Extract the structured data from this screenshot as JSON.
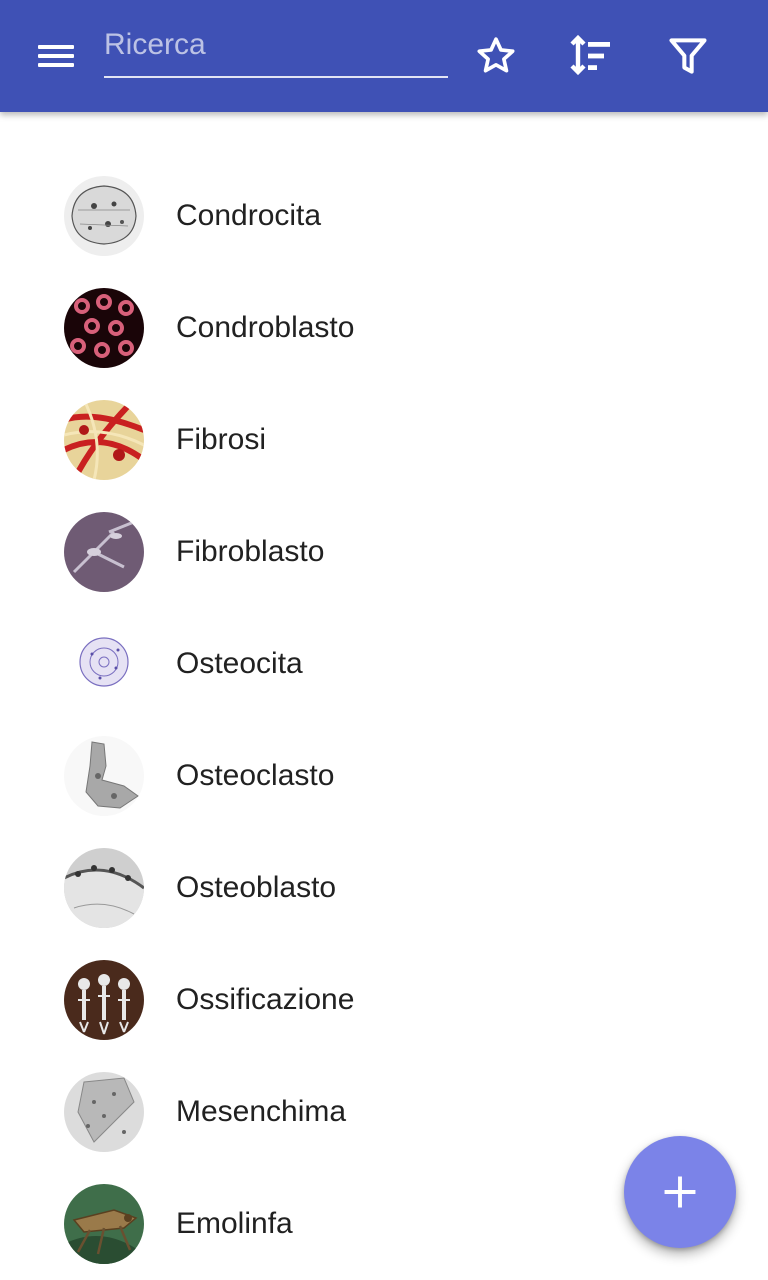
{
  "appbar": {
    "color": "#3f51b5",
    "menu_icon": "menu-icon",
    "search": {
      "placeholder": "Ricerca",
      "value": ""
    },
    "actions": [
      {
        "name": "favorites",
        "icon": "star-outline-icon"
      },
      {
        "name": "sort",
        "icon": "sort-icon"
      },
      {
        "name": "filter",
        "icon": "filter-icon"
      }
    ]
  },
  "list": {
    "items": [
      {
        "label": "Condrocita"
      },
      {
        "label": "Condroblasto"
      },
      {
        "label": "Fibrosi"
      },
      {
        "label": "Fibroblasto"
      },
      {
        "label": "Osteocita"
      },
      {
        "label": "Osteoclasto"
      },
      {
        "label": "Osteoblasto"
      },
      {
        "label": "Ossificazione"
      },
      {
        "label": "Mesenchima"
      },
      {
        "label": "Emolinfa"
      }
    ]
  },
  "fab": {
    "icon": "plus-icon",
    "color": "#7b83e8"
  }
}
